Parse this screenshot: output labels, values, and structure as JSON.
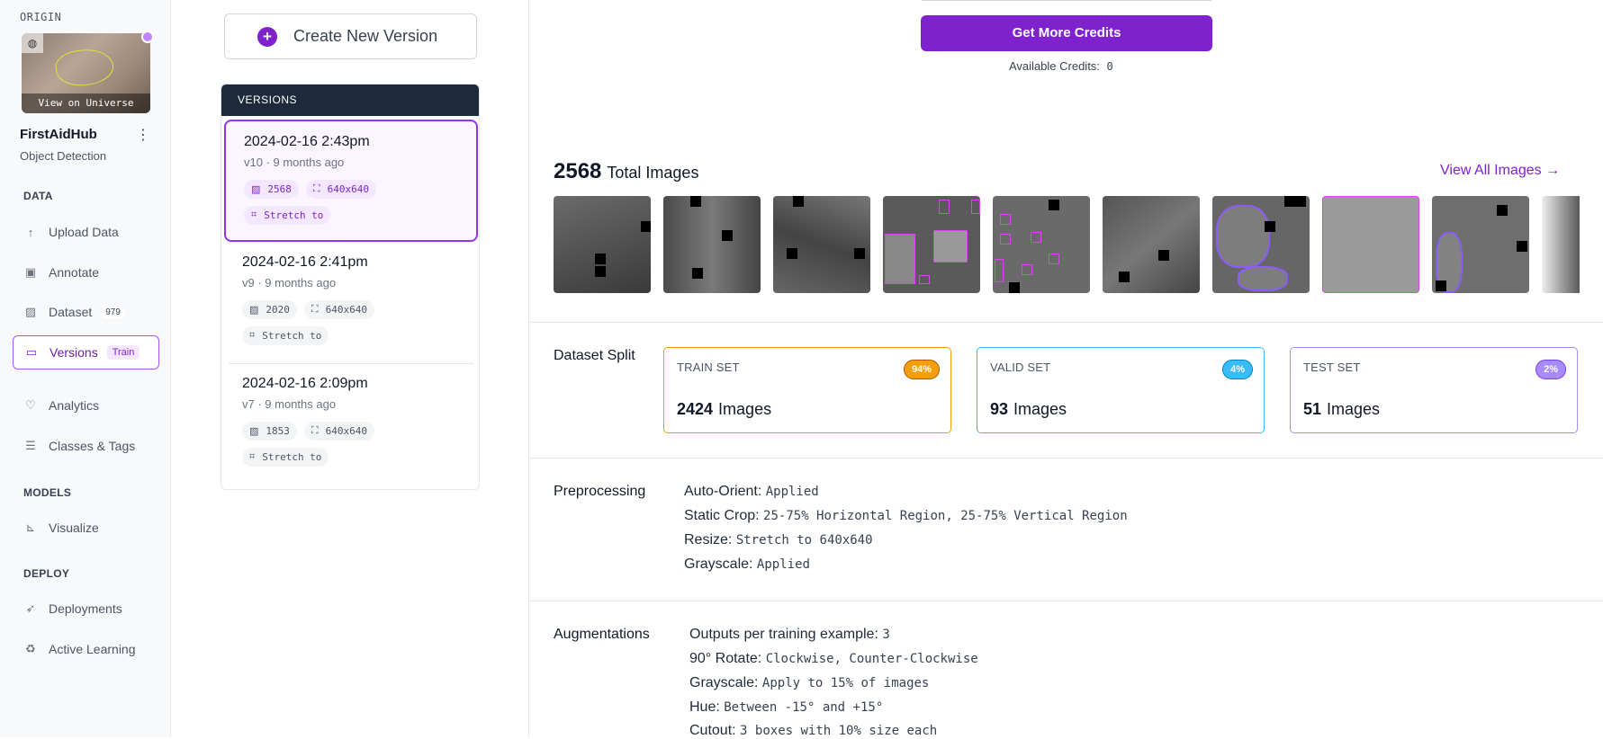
{
  "sidebar": {
    "origin_label": "ORIGIN",
    "view_universe": "View on Universe",
    "project_name": "FirstAidHub",
    "project_type": "Object Detection",
    "sections": {
      "data": "DATA",
      "models": "MODELS",
      "deploy": "DEPLOY"
    },
    "items": [
      {
        "label": "Upload Data",
        "icon": "upload-icon"
      },
      {
        "label": "Annotate",
        "icon": "annotate-icon"
      },
      {
        "label": "Dataset",
        "icon": "dataset-icon",
        "badge": "979"
      },
      {
        "label": "Versions",
        "icon": "versions-icon",
        "badge": "Train"
      },
      {
        "label": "Analytics",
        "icon": "analytics-icon"
      },
      {
        "label": "Classes & Tags",
        "icon": "classes-icon"
      },
      {
        "label": "Visualize",
        "icon": "visualize-icon"
      },
      {
        "label": "Deployments",
        "icon": "deployments-icon"
      },
      {
        "label": "Active Learning",
        "icon": "active-learning-icon"
      }
    ]
  },
  "versions": {
    "create_label": "Create New Version",
    "header": "VERSIONS",
    "list": [
      {
        "date": "2024-02-16 2:43pm",
        "sub": "v10 · 9 months ago",
        "images": "2568",
        "size": "640x640",
        "resize": "Stretch to"
      },
      {
        "date": "2024-02-16 2:41pm",
        "sub": "v9 · 9 months ago",
        "images": "2020",
        "size": "640x640",
        "resize": "Stretch to"
      },
      {
        "date": "2024-02-16 2:09pm",
        "sub": "v7 · 9 months ago",
        "images": "1853",
        "size": "640x640",
        "resize": "Stretch to"
      }
    ]
  },
  "main": {
    "credits_button": "Get More Credits",
    "available_credits_label": "Available Credits:",
    "available_credits_value": "0",
    "total_images_count": "2568",
    "total_images_label": "Total Images",
    "view_all": "View All Images →",
    "dataset_split_title": "Dataset Split",
    "splits": [
      {
        "label": "TRAIN SET",
        "pct": "94%",
        "count": "2424",
        "unit": "Images",
        "color": "#f59e0b"
      },
      {
        "label": "VALID SET",
        "pct": "4%",
        "count": "93",
        "unit": "Images",
        "color": "#38bdf8"
      },
      {
        "label": "TEST SET",
        "pct": "2%",
        "count": "51",
        "unit": "Images",
        "color": "#a78bfa"
      }
    ],
    "preprocessing_title": "Preprocessing",
    "preprocessing": [
      {
        "key": "Auto-Orient:",
        "value": "Applied"
      },
      {
        "key": "Static Crop:",
        "value": "25-75% Horizontal Region, 25-75% Vertical Region"
      },
      {
        "key": "Resize:",
        "value": "Stretch to 640x640"
      },
      {
        "key": "Grayscale:",
        "value": "Applied"
      }
    ],
    "augmentations_title": "Augmentations",
    "augmentations": [
      {
        "key": "Outputs per training example:",
        "value": "3"
      },
      {
        "key": "90° Rotate:",
        "value": "Clockwise, Counter-Clockwise"
      },
      {
        "key": "Grayscale:",
        "value": "Apply to 15% of images"
      },
      {
        "key": "Hue:",
        "value": "Between -15° and +15°"
      },
      {
        "key": "Cutout:",
        "value": "3 boxes with 10% size each"
      }
    ]
  }
}
